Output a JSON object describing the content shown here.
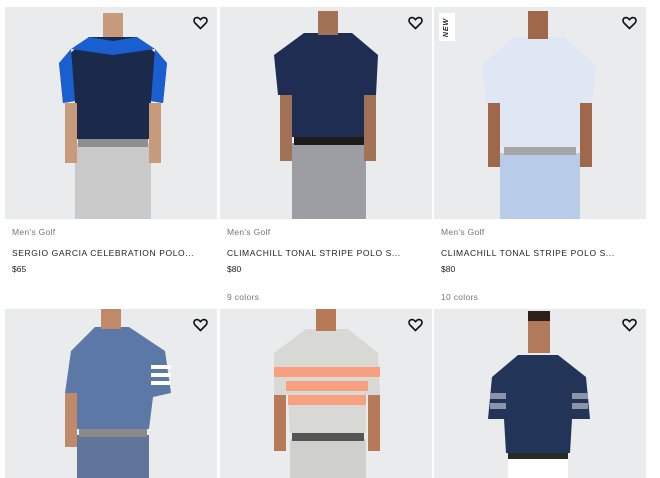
{
  "products": [
    {
      "category": "Men's Golf",
      "name": "SERGIO GARCIA CELEBRATION POLO...",
      "price": "$65",
      "colors": "",
      "badge": "",
      "wishlist_icon": "heart-icon",
      "shirt": "#1b2a4a",
      "accent": "#1a5fcf",
      "pants": "#c9c9c9"
    },
    {
      "category": "Men's Golf",
      "name": "CLIMACHILL TONAL STRIPE POLO S...",
      "price": "$80",
      "colors": "9 colors",
      "badge": "",
      "wishlist_icon": "heart-icon",
      "shirt": "#1f2d52",
      "accent": "#1f2d52",
      "pants": "#9d9ea3"
    },
    {
      "category": "Men's Golf",
      "name": "CLIMACHILL TONAL STRIPE POLO S...",
      "price": "$80",
      "colors": "10 colors",
      "badge": "NEW",
      "wishlist_icon": "heart-icon",
      "shirt": "#dfe6f4",
      "accent": "#c9d6ee",
      "pants": "#b8cbe8"
    },
    {
      "category": "",
      "name": "",
      "price": "",
      "colors": "",
      "badge": "",
      "wishlist_icon": "heart-icon",
      "shirt": "#5b78a6",
      "accent": "#ffffff",
      "pants": "#5f7599"
    },
    {
      "category": "",
      "name": "",
      "price": "",
      "colors": "",
      "badge": "",
      "wishlist_icon": "heart-icon",
      "shirt": "#f6a07f",
      "accent": "#d8d8d4",
      "pants": "#cfcfcb"
    },
    {
      "category": "",
      "name": "",
      "price": "",
      "colors": "",
      "badge": "",
      "wishlist_icon": "heart-icon",
      "shirt": "#233459",
      "accent": "#8b94a8",
      "pants": "#ffffff"
    }
  ]
}
